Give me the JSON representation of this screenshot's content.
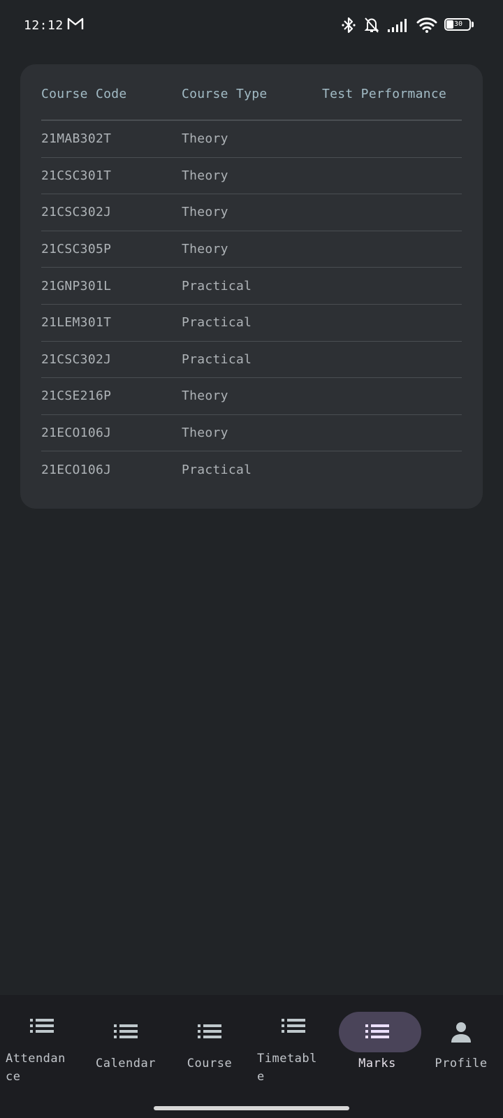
{
  "status_bar": {
    "time": "12:12",
    "battery_level": "30",
    "icons": [
      "gmail-icon",
      "bluetooth-icon",
      "bell-off-icon",
      "signal-icon",
      "wifi-icon",
      "battery-icon"
    ]
  },
  "table": {
    "headers": {
      "course_code": "Course Code",
      "course_type": "Course Type",
      "test_performance": "Test Performance"
    },
    "rows": [
      {
        "code": "21MAB302T",
        "type": "Theory",
        "performance": ""
      },
      {
        "code": "21CSC301T",
        "type": "Theory",
        "performance": ""
      },
      {
        "code": "21CSC302J",
        "type": "Theory",
        "performance": ""
      },
      {
        "code": "21CSC305P",
        "type": "Theory",
        "performance": ""
      },
      {
        "code": "21GNP301L",
        "type": "Practical",
        "performance": ""
      },
      {
        "code": "21LEM301T",
        "type": "Practical",
        "performance": ""
      },
      {
        "code": "21CSC302J",
        "type": "Practical",
        "performance": ""
      },
      {
        "code": "21CSE216P",
        "type": "Theory",
        "performance": ""
      },
      {
        "code": "21ECO106J",
        "type": "Theory",
        "performance": ""
      },
      {
        "code": "21ECO106J",
        "type": "Practical",
        "performance": ""
      }
    ]
  },
  "bottom_nav": {
    "items": [
      {
        "label_line1": "Attendan",
        "label_line2": "ce",
        "icon": "list-icon"
      },
      {
        "label_line1": "Calendar",
        "label_line2": "",
        "icon": "list-icon"
      },
      {
        "label_line1": "Course",
        "label_line2": "",
        "icon": "list-icon"
      },
      {
        "label_line1": "Timetabl",
        "label_line2": "e",
        "icon": "list-icon"
      },
      {
        "label_line1": "Marks",
        "label_line2": "",
        "icon": "list-icon"
      },
      {
        "label_line1": "Profile",
        "label_line2": "",
        "icon": "person-icon"
      }
    ],
    "active": "Marks",
    "colors": {
      "active_pill": "#4a4459",
      "icon": "#bfc8cc",
      "active_icon": "#ece0ff"
    }
  },
  "colors": {
    "background": "#212427",
    "card": "#2d3034",
    "header_text": "#a3bcc6",
    "row_text": "#aeb3b7"
  }
}
